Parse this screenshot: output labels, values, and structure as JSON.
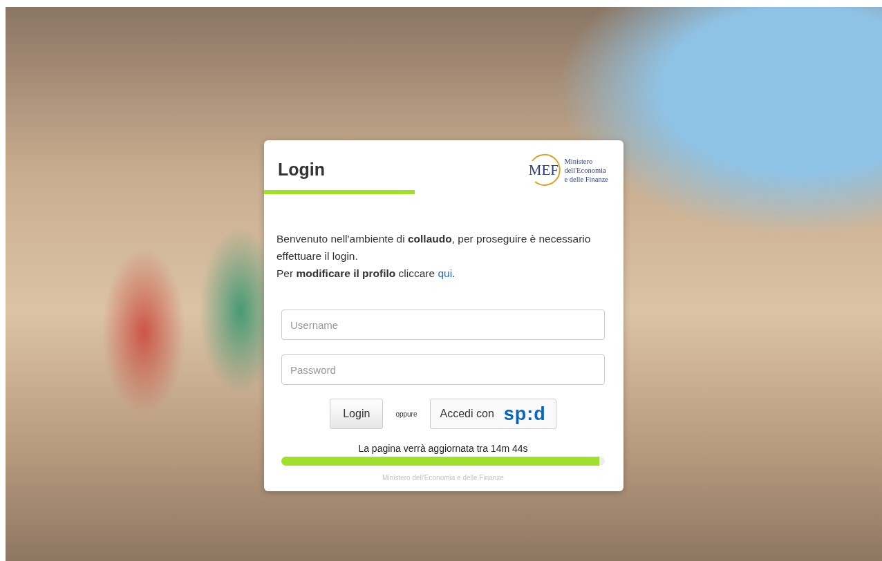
{
  "title": "Login",
  "logo": {
    "mark": "MEF",
    "lines": [
      "Ministero",
      "dell'Economia",
      "e delle Finanze"
    ]
  },
  "welcome": [
    "Benvenuto nell'ambiente di **collaudo**, per proseguire è necessario effettuare il login."
  ],
  "profile": {
    "before": "Per **modificare il profilo** cliccare ",
    "link": "qui",
    "after": "."
  },
  "fields": [
    {
      "placeholder": "Username"
    },
    {
      "placeholder": "Password"
    }
  ],
  "login_button": "Login",
  "separator": "oppure",
  "spid_button": {
    "label": "Accedi con",
    "logo": "sp:d"
  },
  "countdown": {
    "text": "La pagina verrà aggiornata tra 14m 44s",
    "level": 0.983
  },
  "footer": "Ministero dell'Economia e delle Finanze"
}
